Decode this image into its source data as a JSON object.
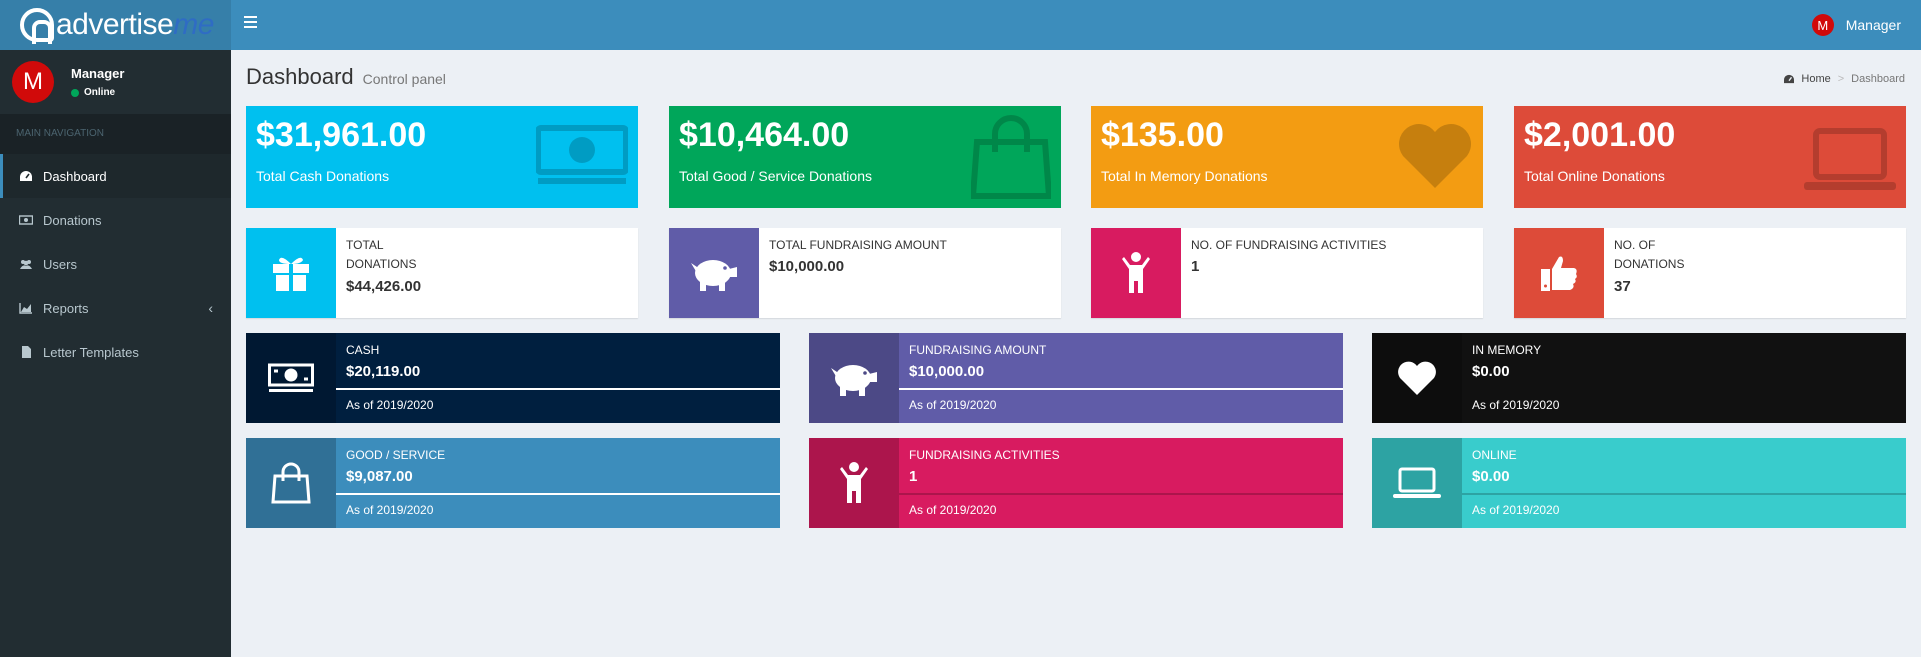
{
  "brand": {
    "name_main": "advertise",
    "name_accent": "me"
  },
  "header": {
    "user_name": "Manager",
    "user_initial": "M"
  },
  "sidebar": {
    "user_name": "Manager",
    "user_initial": "M",
    "status": "Online",
    "nav_header": "MAIN NAVIGATION",
    "items": [
      {
        "label": "Dashboard",
        "icon": "dashboard-icon",
        "active": true
      },
      {
        "label": "Donations",
        "icon": "money-icon"
      },
      {
        "label": "Users",
        "icon": "users-icon"
      },
      {
        "label": "Reports",
        "icon": "chart-icon",
        "arrow": "‹"
      },
      {
        "label": "Letter Templates",
        "icon": "file-icon"
      }
    ]
  },
  "content": {
    "title": "Dashboard",
    "subtitle": "Control panel",
    "breadcrumb": {
      "home": "Home",
      "current": "Dashboard"
    }
  },
  "small_boxes": [
    {
      "amount": "$31,961.00",
      "label": "Total Cash Donations",
      "color": "#00c0ef",
      "icon": "money-icon"
    },
    {
      "amount": "$10,464.00",
      "label": "Total Good / Service Donations",
      "color": "#00a65a",
      "icon": "shopping-bag-icon"
    },
    {
      "amount": "$135.00",
      "label": "Total In Memory Donations",
      "color": "#f39c12",
      "icon": "heart-icon"
    },
    {
      "amount": "$2,001.00",
      "label": "Total Online Donations",
      "color": "#dd4b39",
      "icon": "laptop-icon"
    }
  ],
  "info_boxes": [
    {
      "text": "TOTAL DONATIONS",
      "number": "$44,426.00",
      "color": "#00c0ef",
      "icon": "gift-icon"
    },
    {
      "text": "TOTAL FUNDRAISING AMOUNT",
      "number": "$10,000.00",
      "color": "#605ca8",
      "icon": "piggy-bank-icon"
    },
    {
      "text": "NO. OF FUNDRAISING ACTIVITIES",
      "number": "1",
      "color": "#d81b60",
      "icon": "child-icon"
    },
    {
      "text": "NO. OF DONATIONS",
      "number": "37",
      "color": "#dd4b39",
      "icon": "thumbs-up-icon"
    }
  ],
  "progress_boxes": [
    {
      "title": "CASH",
      "number": "$20,119.00",
      "desc": "As of 2019/2020",
      "color": "#001f3f",
      "icon": "money-icon",
      "progress": 100
    },
    {
      "title": "FUNDRAISING AMOUNT",
      "number": "$10,000.00",
      "desc": "As of 2019/2020",
      "color": "#605ca8",
      "icon": "piggy-bank-icon",
      "progress": 100
    },
    {
      "title": "IN MEMORY",
      "number": "$0.00",
      "desc": "As of 2019/2020",
      "color": "#111111",
      "icon": "heart-icon",
      "progress": 0
    },
    {
      "title": "GOOD / SERVICE",
      "number": "$9,087.00",
      "desc": "As of 2019/2020",
      "color": "#3c8dbc",
      "icon": "shopping-bag-icon",
      "progress": 100
    },
    {
      "title": "FUNDRAISING ACTIVITIES",
      "number": "1",
      "desc": "As of 2019/2020",
      "color": "#d81b60",
      "icon": "child-icon",
      "progress": 0
    },
    {
      "title": "ONLINE",
      "number": "$0.00",
      "desc": "As of 2019/2020",
      "color": "#39cccc",
      "icon": "laptop-icon",
      "progress": 0
    }
  ]
}
